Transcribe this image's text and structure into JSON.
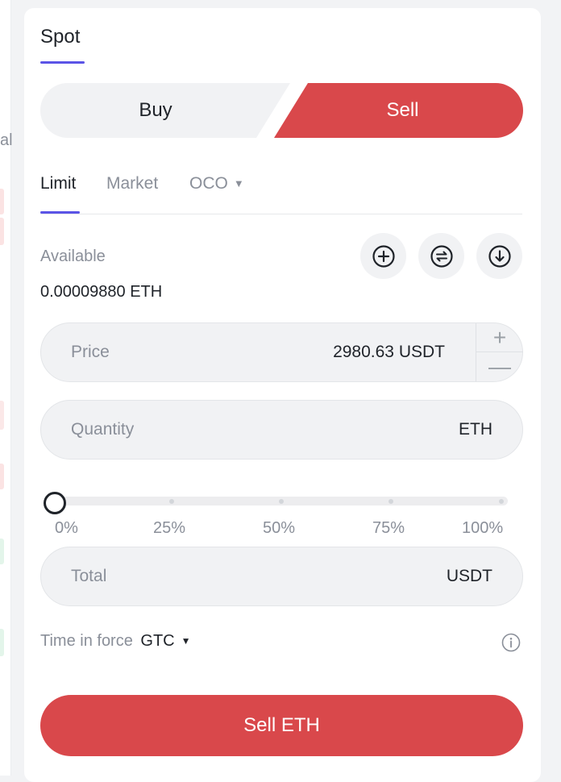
{
  "left_strip": {
    "cut_text": "al"
  },
  "header": {
    "tab_label": "Spot"
  },
  "side": {
    "buy_label": "Buy",
    "sell_label": "Sell",
    "selected": "sell"
  },
  "order_types": [
    {
      "label": "Limit",
      "active": true
    },
    {
      "label": "Market",
      "active": false
    },
    {
      "label": "OCO",
      "active": false,
      "has_dropdown": true
    }
  ],
  "available": {
    "label": "Available",
    "value": "0.00009880 ETH"
  },
  "actions": {
    "icons": [
      "plus-circle-icon",
      "swap-circle-icon",
      "download-circle-icon"
    ]
  },
  "price": {
    "label": "Price",
    "value": "2980.63 USDT",
    "increment": "+",
    "decrement": "—"
  },
  "quantity": {
    "label": "Quantity",
    "unit": "ETH",
    "value": ""
  },
  "slider": {
    "marks": [
      "0%",
      "25%",
      "50%",
      "75%",
      "100%"
    ],
    "value_percent": 0
  },
  "total": {
    "label": "Total",
    "unit": "USDT",
    "value": ""
  },
  "time_in_force": {
    "label": "Time in force",
    "value": "GTC"
  },
  "submit": {
    "label": "Sell ETH"
  },
  "colors": {
    "sell": "#d9484b",
    "accent": "#5b54e6",
    "muted_text": "#8a8f99",
    "field_bg": "#f1f2f4"
  }
}
